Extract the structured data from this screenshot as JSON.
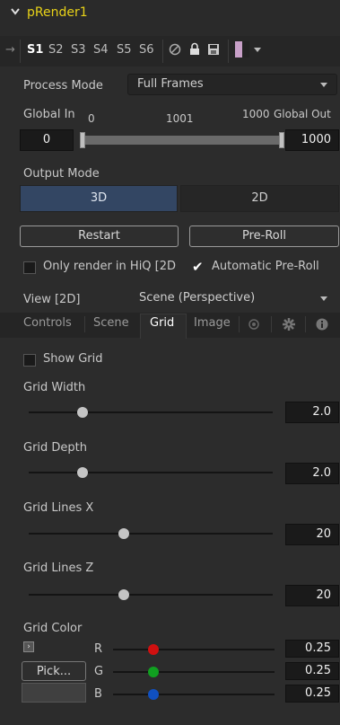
{
  "node": {
    "title": "pRender1"
  },
  "toolbar": {
    "slots": [
      "S1",
      "S2",
      "S3",
      "S4",
      "S5",
      "S6"
    ],
    "active_slot": "S1",
    "icons": [
      "pin-icon",
      "bypass-icon",
      "lock-icon",
      "save-icon",
      "color-swatch-icon",
      "chevron-down-icon"
    ]
  },
  "process_mode": {
    "label": "Process Mode",
    "value": "Full Frames"
  },
  "global_range": {
    "in_label": "Global In",
    "out_label": "Global Out",
    "in_tick": "0",
    "mid_tick": "1001",
    "end_tick": "1000",
    "in_value": "0",
    "out_value": "1000"
  },
  "output_mode": {
    "label": "Output Mode",
    "options": [
      "3D",
      "2D"
    ],
    "selected": "3D"
  },
  "buttons": {
    "restart": "Restart",
    "preroll": "Pre-Roll"
  },
  "checks": {
    "hiq": {
      "label": "Only render in HiQ [2D",
      "checked": false
    },
    "auto_preroll": {
      "label": "Automatic Pre-Roll",
      "checked": true
    }
  },
  "view": {
    "label": "View [2D]",
    "value": "Scene (Perspective)"
  },
  "tabs": [
    "Controls",
    "Scene",
    "Grid",
    "Image"
  ],
  "active_tab": "Grid",
  "grid": {
    "show_grid": {
      "label": "Show Grid",
      "checked": false
    },
    "width": {
      "label": "Grid Width",
      "value": "2.0",
      "fraction": 0.22
    },
    "depth": {
      "label": "Grid Depth",
      "value": "2.0",
      "fraction": 0.22
    },
    "lines_x": {
      "label": "Grid Lines X",
      "value": "20",
      "fraction": 0.39
    },
    "lines_z": {
      "label": "Grid Lines Z",
      "value": "20",
      "fraction": 0.39
    },
    "color": {
      "label": "Grid Color",
      "pick_label": "Pick...",
      "channels": [
        {
          "name": "R",
          "value": "0.25",
          "fraction": 0.25,
          "color": "#d01010"
        },
        {
          "name": "G",
          "value": "0.25",
          "fraction": 0.25,
          "color": "#10a020"
        },
        {
          "name": "B",
          "value": "0.25",
          "fraction": 0.25,
          "color": "#1050c0"
        }
      ]
    }
  },
  "colors": {
    "title": "#e8d218",
    "accent": "#334663"
  }
}
